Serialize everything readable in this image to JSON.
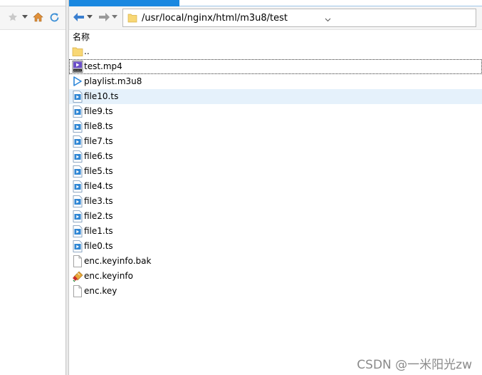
{
  "window": {
    "address_path": "/usr/local/nginx/html/m3u8/test"
  },
  "header": {
    "name_column": "名称"
  },
  "files": [
    {
      "name": "..",
      "icon": "folder-icon"
    },
    {
      "name": "test.mp4",
      "icon": "mp4-video-icon"
    },
    {
      "name": "playlist.m3u8",
      "icon": "play-triangle-icon"
    },
    {
      "name": "file10.ts",
      "icon": "ts-file-icon"
    },
    {
      "name": "file9.ts",
      "icon": "ts-file-icon"
    },
    {
      "name": "file8.ts",
      "icon": "ts-file-icon"
    },
    {
      "name": "file7.ts",
      "icon": "ts-file-icon"
    },
    {
      "name": "file6.ts",
      "icon": "ts-file-icon"
    },
    {
      "name": "file5.ts",
      "icon": "ts-file-icon"
    },
    {
      "name": "file4.ts",
      "icon": "ts-file-icon"
    },
    {
      "name": "file3.ts",
      "icon": "ts-file-icon"
    },
    {
      "name": "file2.ts",
      "icon": "ts-file-icon"
    },
    {
      "name": "file1.ts",
      "icon": "ts-file-icon"
    },
    {
      "name": "file0.ts",
      "icon": "ts-file-icon"
    },
    {
      "name": "enc.keyinfo.bak",
      "icon": "blank-file-icon"
    },
    {
      "name": "enc.keyinfo",
      "icon": "key-file-icon"
    },
    {
      "name": "enc.key",
      "icon": "blank-file-icon"
    }
  ],
  "selected_index": 3,
  "focused_index": 1,
  "watermark": "CSDN @一米阳光zw",
  "colors": {
    "accent": "#1a88e0",
    "selection": "#e5f1fb",
    "folder": "#f8d775"
  }
}
